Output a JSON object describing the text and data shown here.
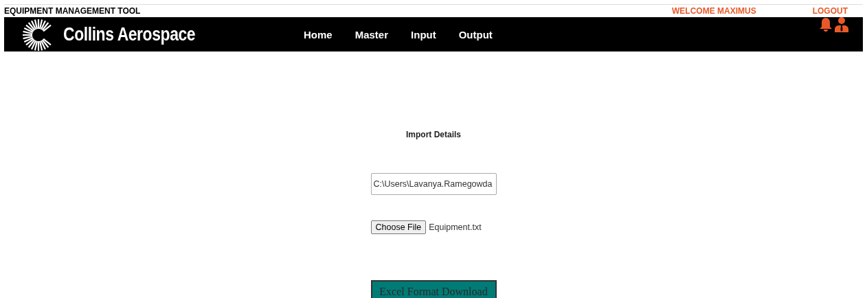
{
  "app_title": "EQUIPMENT MANAGEMENT TOOL",
  "welcome": "WELCOME MAXIMUS",
  "logout": "LOGOUT",
  "brand": "Collins Aerospace",
  "nav": [
    {
      "label": "Home"
    },
    {
      "label": "Master"
    },
    {
      "label": "Input"
    },
    {
      "label": "Output"
    }
  ],
  "section_title": "Import Details",
  "path_field": {
    "value": "C:\\Users\\Lavanya.Ramegowda"
  },
  "file_picker": {
    "button": "Choose File",
    "file_name": "Equipment.txt"
  },
  "download_button": "Excel Format Download"
}
